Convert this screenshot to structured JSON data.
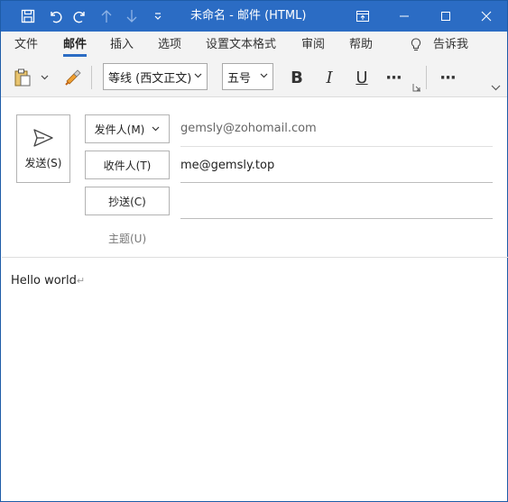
{
  "titlebar": {
    "title": "未命名  -  邮件 (HTML)",
    "icons": [
      "save-icon",
      "undo-icon",
      "redo-icon",
      "up-arrow-icon",
      "down-arrow-icon",
      "customize-qat-icon",
      "ribbon-display-icon",
      "minimize-icon",
      "maximize-icon",
      "close-icon"
    ]
  },
  "tabs": [
    "文件",
    "邮件",
    "插入",
    "选项",
    "设置文本格式",
    "审阅",
    "帮助"
  ],
  "active_tab": "邮件",
  "tell_me": "告诉我",
  "toolbar": {
    "font": "等线 (西文正文)",
    "size": "五号",
    "bold": "B",
    "italic": "I",
    "underline": "U",
    "more": "···"
  },
  "compose": {
    "send_label": "发送(S)",
    "from_label": "发件人(M)",
    "from_value": "gemsly@zohomail.com",
    "to_label": "收件人(T)",
    "to_value": "me@gemsly.top",
    "cc_label": "抄送(C)",
    "cc_value": "",
    "subject_label": "主题(U)",
    "subject_value": ""
  },
  "body": {
    "text": "Hello world",
    "return_mark": "↵"
  },
  "colors": {
    "titlebar": "#2b6cc4",
    "ribbon": "#f3f3f3",
    "accent": "#2b6cc4"
  }
}
